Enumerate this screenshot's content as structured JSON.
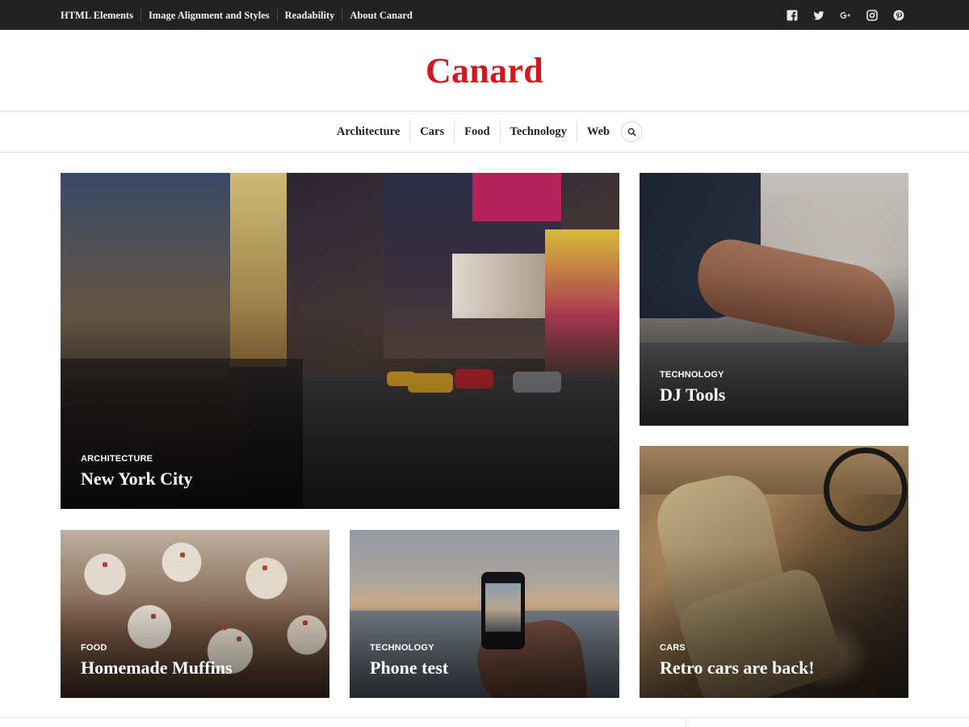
{
  "topbar": {
    "links": [
      "HTML Elements",
      "Image Alignment and Styles",
      "Readability",
      "About Canard"
    ],
    "social_icons": [
      "facebook-icon",
      "twitter-icon",
      "google-plus-icon",
      "instagram-icon",
      "pinterest-icon"
    ]
  },
  "site": {
    "title": "Canard",
    "brand_color": "#d4161d"
  },
  "main_nav": {
    "items": [
      "Architecture",
      "Cars",
      "Food",
      "Technology",
      "Web"
    ],
    "search_icon": "search-icon"
  },
  "featured": [
    {
      "category": "Architecture",
      "title": "New York City"
    },
    {
      "category": "Technology",
      "title": "DJ Tools"
    },
    {
      "category": "Food",
      "title": "Homemade Muffins"
    },
    {
      "category": "Technology",
      "title": "Phone test"
    },
    {
      "category": "Cars",
      "title": "Retro cars are back!"
    }
  ],
  "colors": {
    "topbar_bg": "#222222",
    "accent": "#d4161d"
  }
}
